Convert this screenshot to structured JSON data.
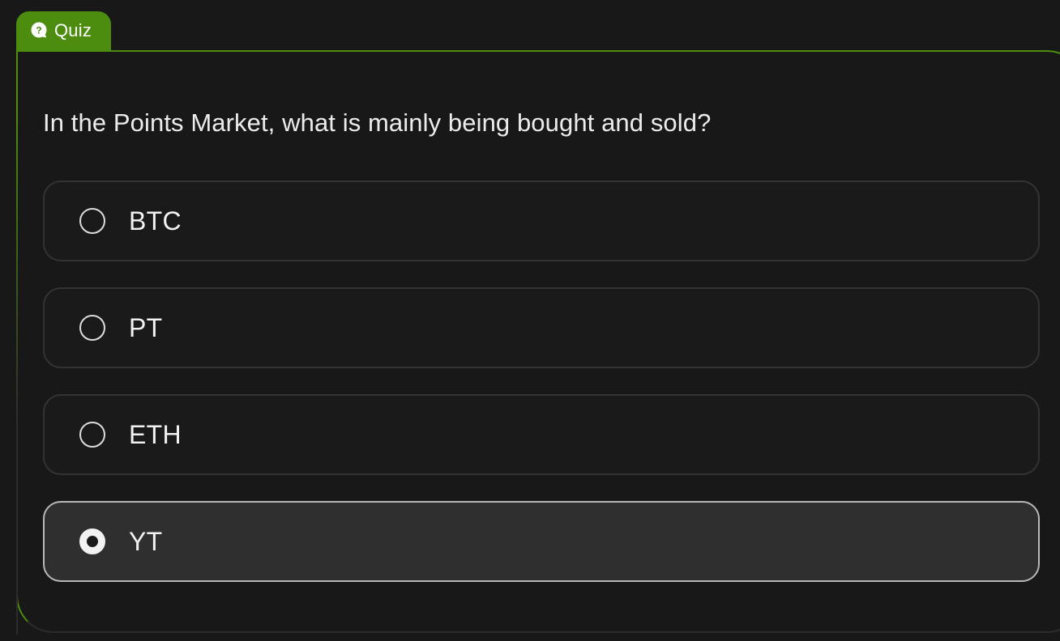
{
  "tab": {
    "label": "Quiz",
    "icon": "question-bubble-icon",
    "color": "#4c8c0f"
  },
  "quiz": {
    "question": "In the Points Market, what is mainly being bought and sold?",
    "options": [
      {
        "label": "BTC",
        "selected": false
      },
      {
        "label": "PT",
        "selected": false
      },
      {
        "label": "ETH",
        "selected": false
      },
      {
        "label": "YT",
        "selected": true
      }
    ],
    "selected_index": 3
  }
}
